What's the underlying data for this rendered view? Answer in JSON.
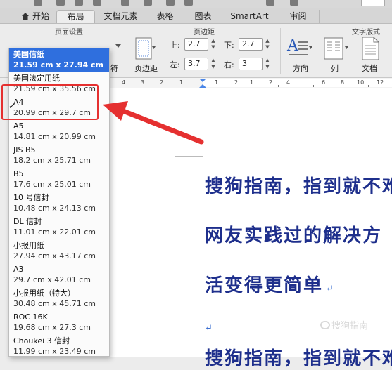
{
  "tabs": [
    {
      "label": "开始",
      "active": false
    },
    {
      "label": "布局",
      "active": true
    },
    {
      "label": "文档元素",
      "active": false
    },
    {
      "label": "表格",
      "active": false
    },
    {
      "label": "图表",
      "active": false
    },
    {
      "label": "SmartArt",
      "active": false
    },
    {
      "label": "审阅",
      "active": false
    }
  ],
  "ribbon": {
    "page_setup_title": "页面设置",
    "margins_title": "页边距",
    "text_direction_title": "文字版式",
    "partial_label": "符",
    "margins_button": "页边距",
    "top_label": "上:",
    "top_value": "2.7",
    "bottom_label": "下:",
    "bottom_value": "2.7",
    "left_label": "左:",
    "left_value": "3.7",
    "right_label": "右:",
    "right_value": "3",
    "direction_button": "方向",
    "columns_button": "列",
    "document_button": "文档"
  },
  "ruler": {
    "labels": [
      "4",
      "3",
      "2",
      "1",
      "1",
      "2",
      "1",
      "2",
      "4",
      "6",
      "8",
      "10",
      "12"
    ]
  },
  "paper_sizes": [
    {
      "name": "美国信纸",
      "size": "21.59 cm x 27.94 cm",
      "highlighted": true,
      "checked": false
    },
    {
      "name": "美国法定用纸",
      "size": "21.59 cm x 35.56 cm",
      "highlighted": false,
      "checked": false
    },
    {
      "name": "A4",
      "size": "20.99 cm x 29.7 cm",
      "highlighted": false,
      "checked": true
    },
    {
      "name": "A5",
      "size": "14.81 cm x 20.99 cm",
      "highlighted": false,
      "checked": false
    },
    {
      "name": "JIS B5",
      "size": "18.2 cm x 25.71 cm",
      "highlighted": false,
      "checked": false
    },
    {
      "name": "B5",
      "size": "17.6 cm x 25.01 cm",
      "highlighted": false,
      "checked": false
    },
    {
      "name": "10 号信封",
      "size": "10.48 cm x 24.13 cm",
      "highlighted": false,
      "checked": false
    },
    {
      "name": "DL 信封",
      "size": "11.01 cm x 22.01 cm",
      "highlighted": false,
      "checked": false
    },
    {
      "name": "小报用纸",
      "size": "27.94 cm x 43.17 cm",
      "highlighted": false,
      "checked": false
    },
    {
      "name": "A3",
      "size": "29.7 cm x 42.01 cm",
      "highlighted": false,
      "checked": false
    },
    {
      "name": "小报用纸（特大）",
      "size": "30.48 cm x 45.71 cm",
      "highlighted": false,
      "checked": false
    },
    {
      "name": "ROC 16K",
      "size": "19.68 cm x 27.3 cm",
      "highlighted": false,
      "checked": false
    },
    {
      "name": "Choukei 3 信封",
      "size": "11.99 cm x 23.49 cm",
      "highlighted": false,
      "checked": false
    }
  ],
  "check_mark": "✓",
  "document": {
    "lines": [
      "搜狗指南，指到就不难",
      "网友实践过的解决方",
      "活变得更简单",
      "",
      "搜狗指南，指到就不难"
    ],
    "para_mark": "↵"
  },
  "watermark": "搜狗指南",
  "colors": {
    "accent": "#2f6fde",
    "doc_text": "#1e2f8c",
    "annotation": "#e53030"
  }
}
